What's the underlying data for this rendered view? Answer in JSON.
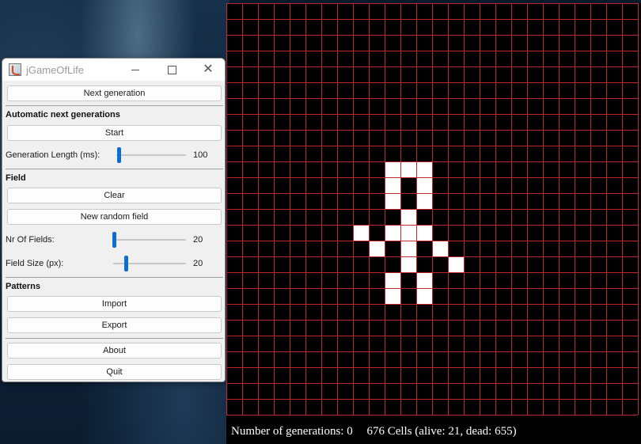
{
  "window": {
    "title": "jGameOfLife"
  },
  "controls": {
    "next_generation_label": "Next generation",
    "automatic_heading": "Automatic next generations",
    "start_label": "Start",
    "generation_length_label": "Generation Length (ms):",
    "generation_length_value": "100",
    "field_heading": "Field",
    "clear_label": "Clear",
    "random_field_label": "New random field",
    "nr_fields_label": "Nr Of Fields:",
    "nr_fields_value": "20",
    "field_size_label": "Field Size (px):",
    "field_size_value": "20",
    "patterns_heading": "Patterns",
    "import_label": "Import",
    "export_label": "Export",
    "about_label": "About",
    "quit_label": "Quit"
  },
  "status": {
    "generations": "Number of generations: 0",
    "cells": "676 Cells (alive: 21, dead: 655)"
  },
  "board": {
    "columns": 26,
    "rows": 26,
    "alive_cells": [
      [
        10,
        10
      ],
      [
        11,
        10
      ],
      [
        12,
        10
      ],
      [
        10,
        11
      ],
      [
        12,
        11
      ],
      [
        10,
        12
      ],
      [
        12,
        12
      ],
      [
        11,
        13
      ],
      [
        8,
        14
      ],
      [
        10,
        14
      ],
      [
        11,
        14
      ],
      [
        12,
        14
      ],
      [
        9,
        15
      ],
      [
        11,
        15
      ],
      [
        13,
        15
      ],
      [
        11,
        16
      ],
      [
        14,
        16
      ],
      [
        10,
        17
      ],
      [
        12,
        17
      ],
      [
        10,
        18
      ],
      [
        12,
        18
      ]
    ],
    "grid_color": "#c0282d",
    "cell_color": "#ffffff",
    "background_color": "#000000"
  },
  "colors": {
    "slider_accent": "#0a6fd0"
  }
}
